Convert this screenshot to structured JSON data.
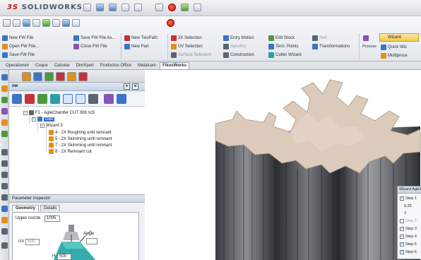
{
  "app": {
    "logo": "SOLIDWORKS"
  },
  "ribbon": {
    "row1": [
      {
        "label": "New FW File",
        "icon": "new-file-icon",
        "color": "#3b74c6"
      },
      {
        "label": "Open FW File...",
        "icon": "open-file-icon",
        "color": "#e2901b"
      },
      {
        "label": "Save FW File",
        "icon": "save-file-icon",
        "color": "#3b74c6"
      }
    ],
    "row2": [
      {
        "label": "Save FW File As...",
        "icon": "save-as-icon",
        "color": "#3b74c6"
      },
      {
        "label": "Close FW File",
        "icon": "close-file-icon",
        "color": "#8754b5"
      }
    ],
    "row3": [
      {
        "label": "New TwoPath",
        "icon": "new-twopath-icon",
        "color": "#c8323a"
      },
      {
        "label": "New Part",
        "icon": "new-part-icon",
        "color": "#3b74c6"
      }
    ],
    "row4": [
      {
        "label": "3X Selection",
        "icon": "3x-selection-icon",
        "color": "#c8323a"
      },
      {
        "label": "UV Selection",
        "icon": "uv-selection-icon",
        "color": "#e2901b"
      },
      {
        "label": "Surface Selection",
        "icon": "surface-selection-icon",
        "color": "#5b6470"
      }
    ],
    "row5": [
      {
        "label": "Entry Motion",
        "icon": "entry-motion-icon",
        "color": "#3b74c6"
      },
      {
        "label": "Synchro",
        "icon": "synchro-icon",
        "color": "#5b6470"
      },
      {
        "label": "Construction",
        "icon": "construction-icon",
        "color": "#5b6470"
      }
    ],
    "row6": [
      {
        "label": "Edit Stock",
        "icon": "edit-stock-icon",
        "color": "#4e9a3a"
      },
      {
        "label": "Tech. Points",
        "icon": "tech-points-icon",
        "color": "#3b74c6"
      },
      {
        "label": "Cutter Wizard",
        "icon": "cutter-wizard-icon",
        "color": "#2a9fa8"
      }
    ],
    "row7": [
      {
        "label": "Sort",
        "icon": "sort-icon",
        "color": "#5b6470"
      },
      {
        "label": "Transformations",
        "icon": "transformations-icon",
        "color": "#3b74c6"
      }
    ],
    "process_label": "Process",
    "wizard_label": "Wizard",
    "quick_wizard_label": "Quick Wiz",
    "multiprocess_label": "Multiproce"
  },
  "tabs": [
    "Operationen",
    "Coque",
    "Calcular",
    "DimXpert",
    "Productos Office",
    "Metalcam",
    "FikusWorks"
  ],
  "active_tab": "FikusWorks",
  "feature_manager": {
    "header_label": "nw",
    "tree": {
      "file": "F1 - AgleChamfer CUT 308 nc5",
      "geo": "Geo",
      "wizard": "Wizard 3",
      "ops": [
        "4 - 2X Roughing until remnant",
        "5 - 2X Skimming until remnant",
        "7 - 2X Skimming until remnant",
        "8 - 2X Remnant cut"
      ]
    }
  },
  "parameter_inspector": {
    "title": "Parameter Inspector",
    "tabs": [
      "Geometry",
      "Details"
    ],
    "upper_nozzle_label": "Upper nozzle",
    "upper_nozzle_value": "1005",
    "uv_label": "UV",
    "uv_value": "500",
    "angle_label": "Angle",
    "h_label": "H",
    "h_value": "500"
  },
  "wizard_panel": {
    "title": "Wizard AgleCha",
    "steps": [
      {
        "label": "Step 1",
        "checked": true
      },
      {
        "label": "0,25",
        "checked": false
      },
      {
        "label": "3",
        "checked": false
      },
      {
        "label": "Step 2",
        "checked": false,
        "dim": true
      },
      {
        "label": "Step 3",
        "checked": true
      },
      {
        "label": "Step 4",
        "checked": true
      },
      {
        "label": "Step 5",
        "checked": true
      },
      {
        "label": "Step 6",
        "checked": true
      }
    ]
  },
  "colors": {
    "part_top": "#dcc9bb",
    "part_side_dark": "#2c2e32",
    "part_side_mid": "#6f7278",
    "accent": "#316ac5"
  }
}
